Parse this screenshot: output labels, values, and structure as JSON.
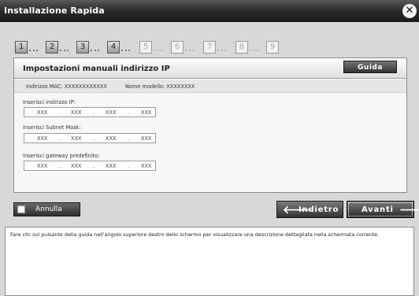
{
  "window": {
    "title": "Installazione Rapida",
    "close_icon": "close-icon"
  },
  "steps": {
    "items": [
      {
        "number": "1",
        "state": "current"
      },
      {
        "number": "2",
        "state": "done"
      },
      {
        "number": "3",
        "state": "done"
      },
      {
        "number": "4",
        "state": "done"
      },
      {
        "number": "5",
        "state": "pending"
      },
      {
        "number": "6",
        "state": "pending"
      },
      {
        "number": "7",
        "state": "pending"
      },
      {
        "number": "8",
        "state": "pending"
      },
      {
        "number": "9",
        "state": "pending"
      }
    ]
  },
  "panel": {
    "title": "Impostazioni manuali indirizzo IP",
    "guide_label": "Guida",
    "mac": "Indirizzo MAC: XXXXXXXXXXXX",
    "model": "Nome modello: XXXXXXXX",
    "fields": [
      {
        "label": "Inserisci indirizzo IP:",
        "octets": [
          "XXX",
          "XXX",
          "XXX",
          "XXX"
        ]
      },
      {
        "label": "Inserisci Subnet Mask:",
        "octets": [
          "XXX",
          "XXX",
          "XXX",
          "XXX"
        ]
      },
      {
        "label": "Inserisci gateway predefinito:",
        "octets": [
          "XXX",
          "XXX",
          "XXX",
          "XXX"
        ]
      }
    ],
    "separator": "."
  },
  "actions": {
    "cancel_label": "Annulla",
    "back_label": "Indietro",
    "next_label": "Avanti"
  },
  "help": {
    "text": "Fare clic sul pulsante della guida nell'angolo superiore destro dello schermo per visualizzare una descrizione dettagliata nella schermata corrente."
  }
}
